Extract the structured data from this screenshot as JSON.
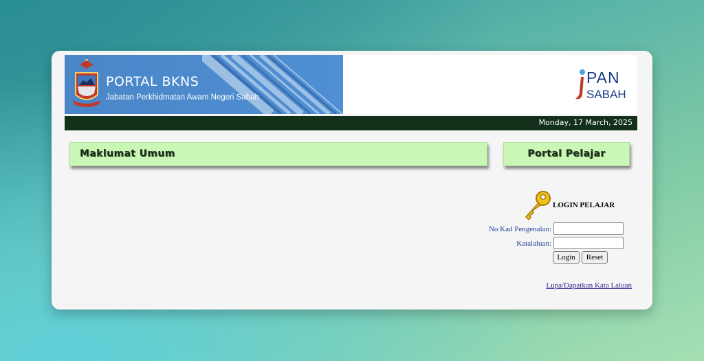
{
  "header": {
    "portal_title": "PORTAL BKNS",
    "portal_subtitle": "Jabatan Perkhidmatan Awam Negeri Sabah",
    "logo_icon": "sabah-crest-icon",
    "jpan_logo_top": "PAN",
    "jpan_logo_bottom": "SABAH",
    "brand_color": "#4a86c8"
  },
  "datebar": {
    "date": "Monday, 17 March, 2025",
    "background": "#12301a"
  },
  "panels": {
    "left_title": "Maklumat Umum",
    "right_title": "Portal Pelajar",
    "panel_color": "#c8f7b6"
  },
  "login": {
    "icon": "key-icon",
    "title": "LOGIN PELAJAR",
    "ic_label": "No Kad Pengenalan:",
    "ic_value": "",
    "password_label": "Katalaluan:",
    "password_value": "",
    "login_button": "Login",
    "reset_button": "Reset",
    "forgot_link": "Lupa/Dapatkan Kata Laluan"
  }
}
